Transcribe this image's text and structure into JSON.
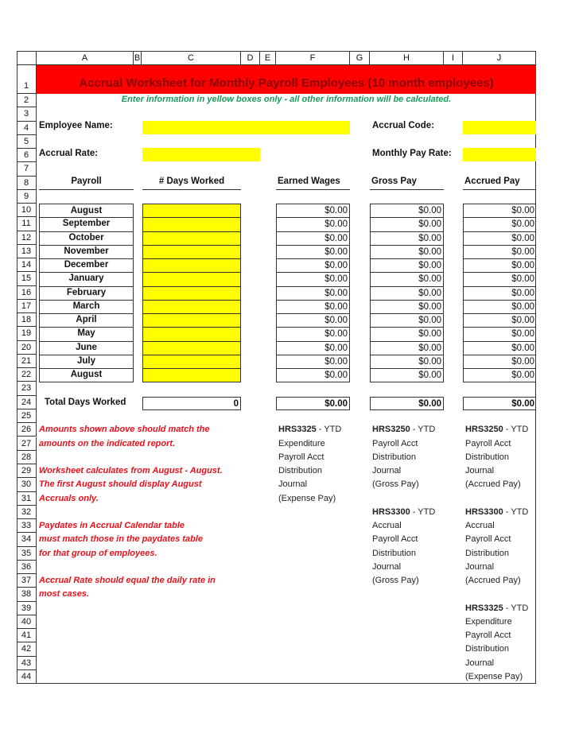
{
  "columns": [
    "A",
    "B",
    "C",
    "D",
    "E",
    "F",
    "G",
    "H",
    "I",
    "J"
  ],
  "rows": [
    "1",
    "2",
    "3",
    "4",
    "5",
    "6",
    "7",
    "8",
    "9",
    "10",
    "11",
    "12",
    "13",
    "14",
    "15",
    "16",
    "17",
    "18",
    "19",
    "20",
    "21",
    "22",
    "23",
    "24",
    "25",
    "26",
    "27",
    "28",
    "29",
    "30",
    "31",
    "32",
    "33",
    "34",
    "35",
    "36",
    "37",
    "38",
    "39",
    "40",
    "41",
    "42",
    "43",
    "44"
  ],
  "title": "Accrual Worksheet for Monthly Payroll Employees (10 month employees)",
  "subtitle": "Enter information in yellow boxes only - all other information will be calculated.",
  "colors": {
    "title_band": "#ff0000",
    "title_text": "#8b0000",
    "input": "#ffff00",
    "note": "#e8101a",
    "subtitle": "#1a9a5a"
  },
  "fields": {
    "employee_name_label": "Employee Name:",
    "employee_name_value": "",
    "accrual_rate_label": "Accrual Rate:",
    "accrual_rate_value": "",
    "accrual_code_label": "Accrual Code:",
    "accrual_code_value": "",
    "monthly_pay_rate_label": "Monthly Pay Rate:",
    "monthly_pay_rate_value": ""
  },
  "table": {
    "headers": [
      "Payroll",
      "# Days Worked",
      "Earned Wages",
      "Gross Pay",
      "Accrued Pay"
    ],
    "rows": [
      {
        "month": "August",
        "days": "",
        "earned": "$0.00",
        "gross": "$0.00",
        "accrued": "$0.00"
      },
      {
        "month": "September",
        "days": "",
        "earned": "$0.00",
        "gross": "$0.00",
        "accrued": "$0.00"
      },
      {
        "month": "October",
        "days": "",
        "earned": "$0.00",
        "gross": "$0.00",
        "accrued": "$0.00"
      },
      {
        "month": "November",
        "days": "",
        "earned": "$0.00",
        "gross": "$0.00",
        "accrued": "$0.00"
      },
      {
        "month": "December",
        "days": "",
        "earned": "$0.00",
        "gross": "$0.00",
        "accrued": "$0.00"
      },
      {
        "month": "January",
        "days": "",
        "earned": "$0.00",
        "gross": "$0.00",
        "accrued": "$0.00"
      },
      {
        "month": "February",
        "days": "",
        "earned": "$0.00",
        "gross": "$0.00",
        "accrued": "$0.00"
      },
      {
        "month": "March",
        "days": "",
        "earned": "$0.00",
        "gross": "$0.00",
        "accrued": "$0.00"
      },
      {
        "month": "April",
        "days": "",
        "earned": "$0.00",
        "gross": "$0.00",
        "accrued": "$0.00"
      },
      {
        "month": "May",
        "days": "",
        "earned": "$0.00",
        "gross": "$0.00",
        "accrued": "$0.00"
      },
      {
        "month": "June",
        "days": "",
        "earned": "$0.00",
        "gross": "$0.00",
        "accrued": "$0.00"
      },
      {
        "month": "July",
        "days": "",
        "earned": "$0.00",
        "gross": "$0.00",
        "accrued": "$0.00"
      },
      {
        "month": "August",
        "days": "",
        "earned": "$0.00",
        "gross": "$0.00",
        "accrued": "$0.00"
      }
    ],
    "totals": {
      "label": "Total Days Worked",
      "days": "0",
      "earned": "$0.00",
      "gross": "$0.00",
      "accrued": "$0.00"
    }
  },
  "notes": [
    "Amounts shown above should match the",
    "amounts on the indicated report.",
    "Worksheet calculates from August - August.",
    "The first August should display August",
    "Accruals only.",
    "Paydates in Accrual Calendar table",
    "must match those in the paydates table",
    "for that group of employees.",
    "Accrual Rate should equal the daily rate in",
    "most cases."
  ],
  "reports": {
    "earned": [
      {
        "code": "HRS3325",
        "suffix": " - YTD",
        "lines": [
          "Expenditure",
          "Payroll Acct",
          "Distribution",
          "Journal",
          "(Expense Pay)"
        ]
      }
    ],
    "gross": [
      {
        "code": "HRS3250",
        "suffix": " - YTD",
        "lines": [
          "Payroll Acct",
          "Distribution",
          "Journal",
          "(Gross Pay)"
        ]
      },
      {
        "code": "HRS3300",
        "suffix": " - YTD",
        "lines": [
          "Accrual",
          "Payroll Acct",
          "Distribution",
          "Journal",
          "(Gross Pay)"
        ]
      }
    ],
    "accrued": [
      {
        "code": "HRS3250",
        "suffix": " - YTD",
        "lines": [
          "Payroll Acct",
          "Distribution",
          "Journal",
          "(Accrued Pay)"
        ]
      },
      {
        "code": "HRS3300",
        "suffix": " - YTD",
        "lines": [
          "Accrual",
          "Payroll Acct",
          "Distribution",
          "Journal",
          "(Accrued Pay)"
        ]
      },
      {
        "code": "HRS3325",
        "suffix": " - YTD",
        "lines": [
          "Expenditure",
          "Payroll Acct",
          "Distribution",
          "Journal",
          "(Expense Pay)"
        ]
      }
    ]
  }
}
